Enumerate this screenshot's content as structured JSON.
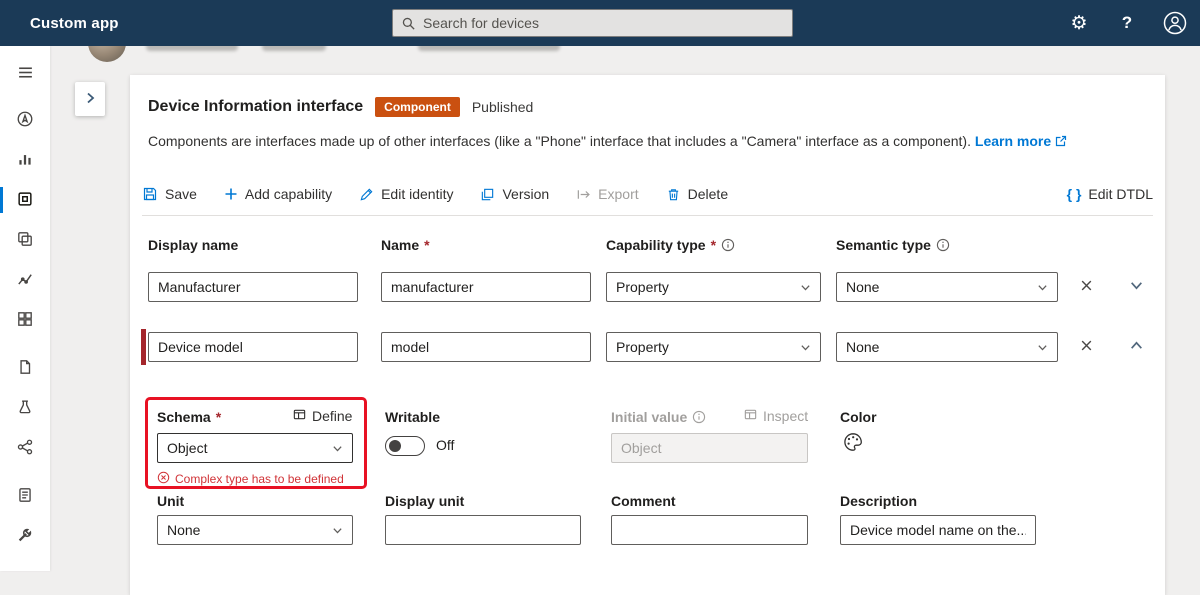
{
  "topbar": {
    "app_title": "Custom app",
    "search_placeholder": "Search for devices"
  },
  "page": {
    "title": "Device Information interface",
    "badge": "Component",
    "status": "Published",
    "description": "Components are interfaces made up of other interfaces (like a \"Phone\" interface that includes a \"Camera\" interface as a component).",
    "learn_more": "Learn more"
  },
  "toolbar": {
    "save": "Save",
    "add_capability": "Add capability",
    "edit_identity": "Edit identity",
    "version": "Version",
    "export": "Export",
    "delete": "Delete",
    "edit_dtdl": "Edit DTDL",
    "braces": "{ }"
  },
  "form": {
    "headers": {
      "display_name": "Display name",
      "name": "Name",
      "capability_type": "Capability type",
      "semantic_type": "Semantic type",
      "required_mark": "*"
    },
    "rows": [
      {
        "display_name": "Manufacturer",
        "name": "manufacturer",
        "capability_type": "Property",
        "semantic_type": "None"
      },
      {
        "display_name": "Device model",
        "name": "model",
        "capability_type": "Property",
        "semantic_type": "None"
      }
    ]
  },
  "detail": {
    "schema_label": "Schema",
    "define_label": "Define",
    "schema_value": "Object",
    "schema_error": "Complex type has to be defined",
    "writable_label": "Writable",
    "writable_state": "Off",
    "initial_value_label": "Initial value",
    "inspect_label": "Inspect",
    "initial_value_placeholder": "Object",
    "color_label": "Color",
    "unit_label": "Unit",
    "unit_value": "None",
    "display_unit_label": "Display unit",
    "comment_label": "Comment",
    "description_label": "Description",
    "description_value": "Device model name on the..."
  },
  "colors": {
    "topbar": "#1b3a57",
    "accent": "#0078d4",
    "badge": "#ca5010",
    "annotation": "#e81123",
    "error": "#d13438",
    "required": "#a4262c"
  }
}
